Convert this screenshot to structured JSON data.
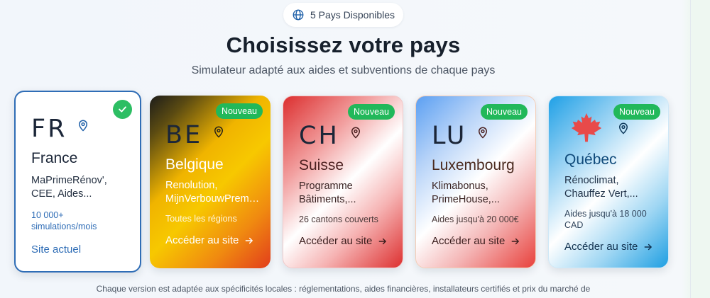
{
  "header": {
    "badge_label": "5 Pays Disponibles",
    "title": "Choisissez votre pays",
    "subtitle": "Simulateur adapté aux aides et subventions de chaque pays"
  },
  "cards": [
    {
      "code": "FR",
      "name": "France",
      "desc_lines": [
        "MaPrimeRénov',",
        "CEE, Aides..."
      ],
      "meta_lines": [
        "10 000+",
        "simulations/mois"
      ],
      "link": "Site actuel",
      "status": "selected",
      "accent": "#2f6db6"
    },
    {
      "code": "BE",
      "name": "Belgique",
      "badge": "Nouveau",
      "desc_lines": [
        "Renolution,",
        "MijnVerbouwPremie..."
      ],
      "meta_lines": [
        "Toutes les régions"
      ],
      "link": "Accéder au site",
      "flag_colors": [
        "#1c1c1a",
        "#f7c800",
        "#e23d1c"
      ]
    },
    {
      "code": "CH",
      "name": "Suisse",
      "badge": "Nouveau",
      "desc_lines": [
        "Programme",
        "Bâtiments,..."
      ],
      "meta_lines": [
        "26 cantons couverts"
      ],
      "link": "Accéder au site",
      "flag_colors": [
        "#dc2f2f",
        "#ffffff"
      ]
    },
    {
      "code": "LU",
      "name": "Luxembourg",
      "badge": "Nouveau",
      "desc_lines": [
        "Klimabonus,",
        "PrimeHouse,..."
      ],
      "meta_lines": [
        "Aides jusqu'à 20 000€"
      ],
      "link": "Accéder au site",
      "flag_colors": [
        "#e8413c",
        "#ffffff",
        "#5b9ff2"
      ]
    },
    {
      "code": "maple-leaf-icon",
      "name": "Québec",
      "badge": "Nouveau",
      "desc_lines": [
        "Rénoclimat,",
        "Chauffez Vert,..."
      ],
      "meta_lines": [
        "Aides jusqu'à 18 000",
        "CAD"
      ],
      "link": "Accéder au site",
      "flag_colors": [
        "#1f9fe2",
        "#ffffff"
      ]
    }
  ],
  "footer": {
    "text": "Chaque version est adaptée aux spécificités locales : réglementations, aides financières, installateurs certifiés et prix du marché de"
  },
  "colors": {
    "badge_green": "#21b85a",
    "selected_border": "#2f6db6",
    "maple_red": "#e84a4a"
  }
}
